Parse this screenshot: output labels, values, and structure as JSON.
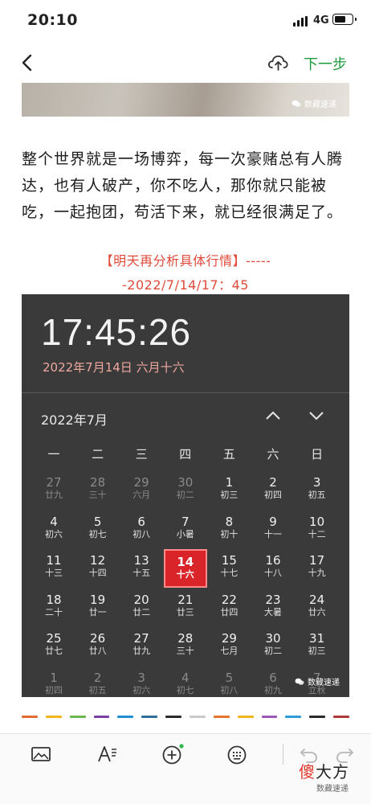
{
  "status_bar": {
    "time": "20:10",
    "network": "4G"
  },
  "nav": {
    "next_label": "下一步",
    "icons": [
      "back-icon",
      "cloud-upload-icon"
    ]
  },
  "image_watermark": "数藏速递",
  "article": {
    "paragraph": "整个世界就是一场博弈，每一次豪赌总有人腾达，也有人破产，你不吃人，那你就只能被吃，一起抱团，苟活下来，就已经很满足了。",
    "note_line1": "【明天再分析具体行情】-----",
    "note_line2": "-2022/7/14/17：45"
  },
  "calendar_screenshot": {
    "clock": "17:45:26",
    "date_line": "2022年7月14日 六月十六",
    "month": "2022年7月",
    "weekdays": [
      "一",
      "二",
      "三",
      "四",
      "五",
      "六",
      "日"
    ],
    "days": [
      {
        "d": "27",
        "l": "廿九",
        "dim": true
      },
      {
        "d": "28",
        "l": "三十",
        "dim": true
      },
      {
        "d": "29",
        "l": "六月",
        "dim": true
      },
      {
        "d": "30",
        "l": "初二",
        "dim": true
      },
      {
        "d": "1",
        "l": "初三"
      },
      {
        "d": "2",
        "l": "初四"
      },
      {
        "d": "3",
        "l": "初五"
      },
      {
        "d": "4",
        "l": "初六"
      },
      {
        "d": "5",
        "l": "初七"
      },
      {
        "d": "6",
        "l": "初八"
      },
      {
        "d": "7",
        "l": "小暑"
      },
      {
        "d": "8",
        "l": "初十"
      },
      {
        "d": "9",
        "l": "十一"
      },
      {
        "d": "10",
        "l": "十二"
      },
      {
        "d": "11",
        "l": "十三"
      },
      {
        "d": "12",
        "l": "十四"
      },
      {
        "d": "13",
        "l": "十五"
      },
      {
        "d": "14",
        "l": "十六",
        "today": true
      },
      {
        "d": "15",
        "l": "十七"
      },
      {
        "d": "16",
        "l": "十八"
      },
      {
        "d": "17",
        "l": "十九"
      },
      {
        "d": "18",
        "l": "二十"
      },
      {
        "d": "19",
        "l": "廿一"
      },
      {
        "d": "20",
        "l": "廿二"
      },
      {
        "d": "21",
        "l": "廿三"
      },
      {
        "d": "22",
        "l": "廿四"
      },
      {
        "d": "23",
        "l": "大暑"
      },
      {
        "d": "24",
        "l": "廿六"
      },
      {
        "d": "25",
        "l": "廿七"
      },
      {
        "d": "26",
        "l": "廿八"
      },
      {
        "d": "27",
        "l": "廿九"
      },
      {
        "d": "28",
        "l": "三十"
      },
      {
        "d": "29",
        "l": "七月"
      },
      {
        "d": "30",
        "l": "初二"
      },
      {
        "d": "31",
        "l": "初三"
      },
      {
        "d": "1",
        "l": "初四",
        "dim": true
      },
      {
        "d": "2",
        "l": "初五",
        "dim": true
      },
      {
        "d": "3",
        "l": "初六",
        "dim": true
      },
      {
        "d": "4",
        "l": "初七",
        "dim": true
      },
      {
        "d": "5",
        "l": "初八",
        "dim": true
      },
      {
        "d": "6",
        "l": "初九",
        "dim": true
      },
      {
        "d": "7",
        "l": "立秋",
        "dim": true
      }
    ],
    "watermark": "数藏速递"
  },
  "color_strip": [
    "#e36b2f",
    "#f2b51c",
    "#6bb64f",
    "#7b3fa3",
    "#1f8fd1",
    "#2d6e9a",
    "#2b2b2b",
    "#c9c9c9",
    "#e8742e",
    "#f2b51c",
    "#9b58b6",
    "#2f9dd8",
    "#2a2a2a",
    "#b23838"
  ],
  "toolbar": {
    "icons": [
      "image-icon",
      "text-format-icon",
      "add-circle-icon",
      "emoji-icon",
      "undo-icon",
      "redo-icon"
    ],
    "brand_part1": "傻",
    "brand_part2": "大方",
    "brand_sub": "数藏速递"
  },
  "colors": {
    "accent_green": "#1e9a3e",
    "note_red": "#e04a3a",
    "today_red": "#d9252a"
  }
}
